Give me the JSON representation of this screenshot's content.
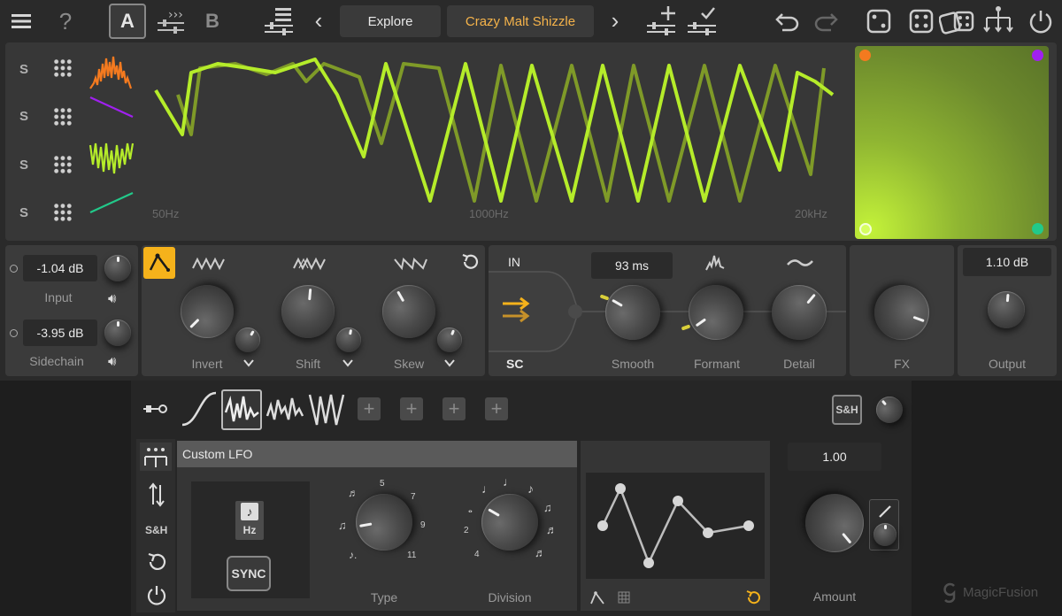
{
  "toolbar": {
    "a_label": "A",
    "b_label": "B",
    "help": "?",
    "prev": "‹",
    "next": "›",
    "explore_label": "Explore",
    "preset_name": "Crazy Malt Shizzle"
  },
  "spectrum": {
    "solo_labels": [
      "S",
      "S",
      "S",
      "S"
    ],
    "freq_low": "50Hz",
    "freq_mid": "1000Hz",
    "freq_high": "20kHz"
  },
  "input": {
    "input_value": "-1.04 dB",
    "input_label": "Input",
    "sidechain_value": "-3.95 dB",
    "sidechain_label": "Sidechain"
  },
  "warp": {
    "invert_label": "Invert",
    "shift_label": "Shift",
    "skew_label": "Skew"
  },
  "router": {
    "in_label": "IN",
    "sc_label": "SC",
    "smooth_value": "93 ms",
    "smooth_label": "Smooth",
    "formant_label": "Formant",
    "detail_label": "Detail"
  },
  "fx": {
    "label": "FX"
  },
  "output": {
    "value": "1.10 dB",
    "label": "Output"
  },
  "modulator": {
    "sh_label": "S&H",
    "side_sh_label": "S&H",
    "title": "Custom LFO",
    "hz_label": "Hz",
    "sync_label": "SYNC",
    "type_label": "Type",
    "type_ticks": [
      "5",
      "7",
      "9",
      "11"
    ],
    "division_label": "Division",
    "division_ticks": [
      "2",
      "4"
    ],
    "amount_value": "1.00",
    "amount_label": "Amount"
  },
  "brand": {
    "name": "MagicFusion"
  },
  "colors": {
    "accent": "#f5b21b",
    "lime": "#b5ec2a",
    "orange": "#f47a1f",
    "purple": "#a020f0",
    "teal": "#22c98a",
    "preset_text": "#f5b34a"
  }
}
